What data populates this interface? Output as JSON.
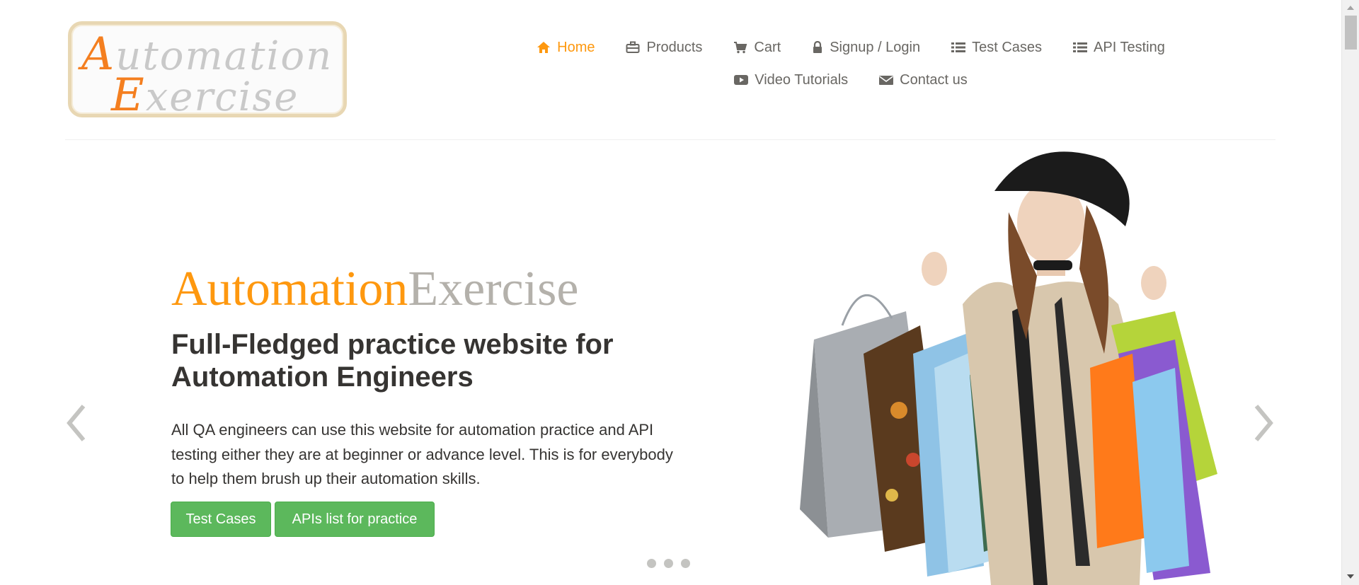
{
  "logo": {
    "line1_cap": "A",
    "line1_rest": "utomation",
    "line2_cap": "E",
    "line2_rest": "xercise"
  },
  "nav": {
    "row1": [
      {
        "label": "Home",
        "icon": "home-icon",
        "active": true
      },
      {
        "label": "Products",
        "icon": "briefcase-icon",
        "active": false
      },
      {
        "label": "Cart",
        "icon": "cart-icon",
        "active": false
      },
      {
        "label": "Signup / Login",
        "icon": "lock-icon",
        "active": false
      },
      {
        "label": "Test Cases",
        "icon": "list-icon",
        "active": false
      },
      {
        "label": "API Testing",
        "icon": "list-icon",
        "active": false
      }
    ],
    "row2": [
      {
        "label": "Video Tutorials",
        "icon": "video-icon",
        "active": false
      },
      {
        "label": "Contact us",
        "icon": "envelope-icon",
        "active": false
      }
    ]
  },
  "slider": {
    "brand_part1": "Automation",
    "brand_part2": "Exercise",
    "headline": "Full-Fledged practice website for Automation Engineers",
    "description": "All QA engineers can use this website for automation practice and API testing either they are at beginner or advance level. This is for everybody to help them brush up their automation skills.",
    "button_test_cases": "Test Cases",
    "button_apis": "APIs list for practice",
    "active_slide": 1,
    "slide_count": 3
  },
  "colors": {
    "accent": "#fe980f",
    "text": "#696763",
    "dark_text": "#363432",
    "button_green": "#5cb85c",
    "brand_grey": "#b4b1ab"
  }
}
